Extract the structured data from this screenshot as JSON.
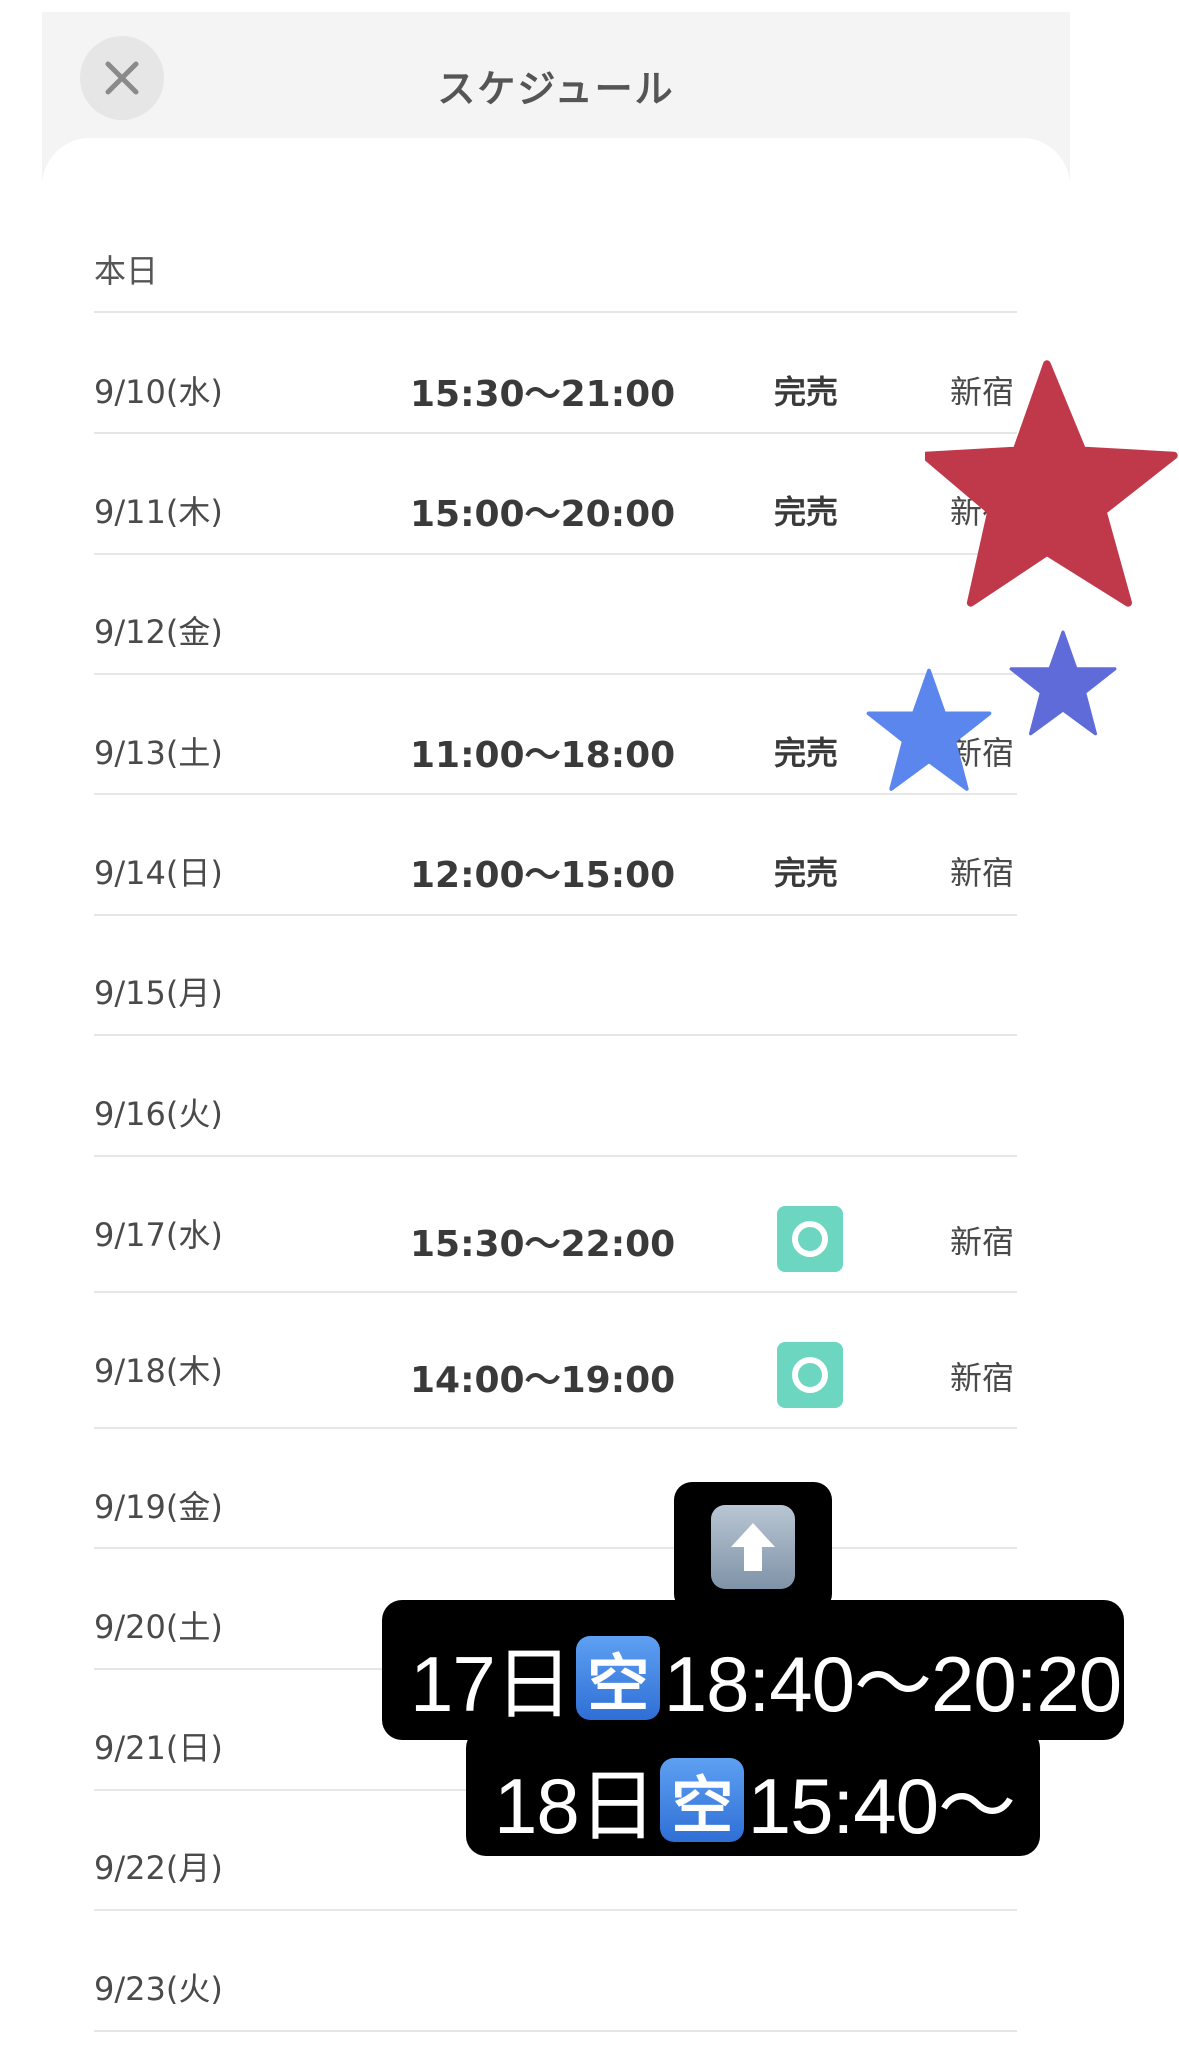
{
  "header": {
    "title": "スケジュール"
  },
  "today_label": "本日",
  "schedule": [
    {
      "date": "9/10(水)",
      "time": "15:30〜21:00",
      "status": "完売",
      "location": "新宿"
    },
    {
      "date": "9/11(木)",
      "time": "15:00〜20:00",
      "status": "完売",
      "location": "新宿"
    },
    {
      "date": "9/12(金)",
      "time": "",
      "status": "",
      "location": ""
    },
    {
      "date": "9/13(土)",
      "time": "11:00〜18:00",
      "status": "完売",
      "location": "新宿"
    },
    {
      "date": "9/14(日)",
      "time": "12:00〜15:00",
      "status": "完売",
      "location": "新宿"
    },
    {
      "date": "9/15(月)",
      "time": "",
      "status": "",
      "location": ""
    },
    {
      "date": "9/16(火)",
      "time": "",
      "status": "",
      "location": ""
    },
    {
      "date": "9/17(水)",
      "time": "15:30〜22:00",
      "status": "available-icon",
      "location": "新宿"
    },
    {
      "date": "9/18(木)",
      "time": "14:00〜19:00",
      "status": "available-icon",
      "location": "新宿"
    },
    {
      "date": "9/19(金)",
      "time": "",
      "status": "",
      "location": ""
    },
    {
      "date": "9/20(土)",
      "time": "",
      "status": "",
      "location": ""
    },
    {
      "date": "9/21(日)",
      "time": "",
      "status": "",
      "location": ""
    },
    {
      "date": "9/22(月)",
      "time": "",
      "status": "",
      "location": ""
    },
    {
      "date": "9/23(火)",
      "time": "",
      "status": "",
      "location": ""
    }
  ],
  "overlay": {
    "line1": {
      "day": "17日",
      "badge": "空",
      "time": "18:40〜20:20"
    },
    "line2": {
      "day": "18日",
      "badge": "空",
      "time": "15:40〜"
    }
  },
  "colors": {
    "available": "#6cd6c0",
    "star_red": "#c0394a",
    "star_blue_1": "#5b86ee",
    "star_blue_2": "#5f6bd8"
  }
}
